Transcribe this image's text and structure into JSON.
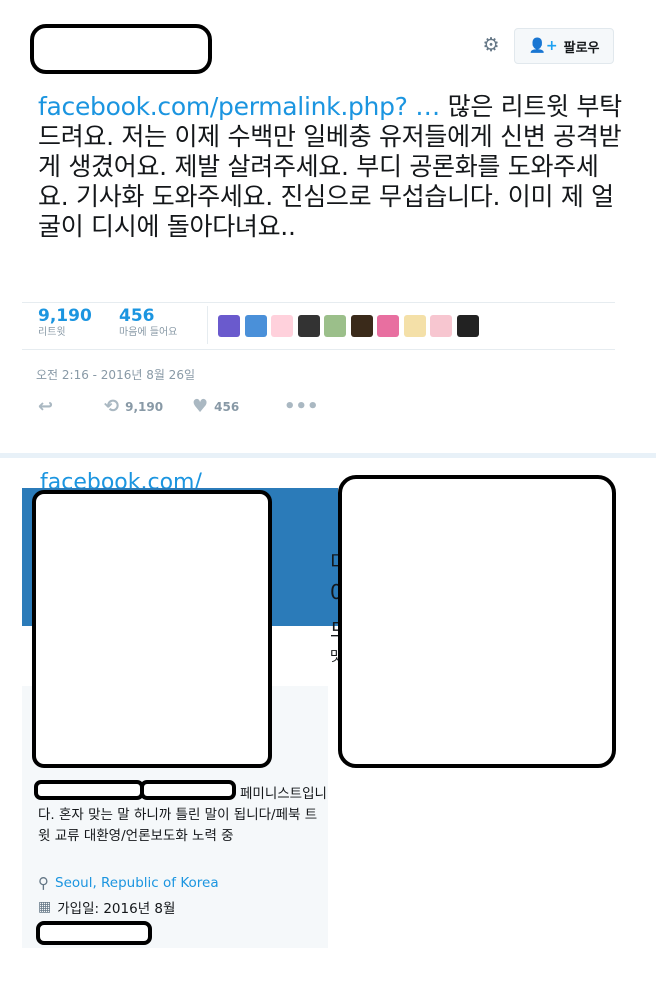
{
  "tweet": {
    "follow_label": "팔로우",
    "link_text": "facebook.com/permalink.php? …",
    "body_text": " 많은 리트윗 부탁드려요. 저는 이제 수백만 일베충 유저들에게 신변 공격받게 생겼어요. 제발 살려주세요. 부디 공론화를 도와주세요. 기사화 도와주세요. 진심으로 무섭습니다. 이미 제 얼굴이 디시에 돌아다녀요..",
    "retweets_count": "9,190",
    "retweets_label": "리트윗",
    "likes_count": "456",
    "likes_label": "마음에 들어요",
    "timestamp": "오전 2:16 - 2016년 8월 26일",
    "action_retweet_count": "9,190",
    "action_like_count": "456",
    "icons": [
      "gear-icon",
      "follow-user-plus-icon",
      "reply-icon",
      "retweet-icon",
      "heart-icon",
      "more-icon"
    ],
    "avatar_colors": [
      "#6a5acd",
      "#4a90d9",
      "#ffd1dc",
      "#333333",
      "#9bbf8a",
      "#3a2a1a",
      "#e86fa0",
      "#f4e0a8",
      "#f7c6d0",
      "#222222"
    ]
  },
  "profile": {
    "bio_text": "페미니스트입니다. 혼자 맞는 말 하니까 틀린 말이 됩니다/페북 트윗 교류 대환영/언론보도화 노력 중",
    "location": "Seoul, Republic of Korea",
    "joined": "가입일: 2016년 8월",
    "url_fragment": "facebook.com/",
    "side_chars": [
      "미",
      "0",
      "므",
      "맛"
    ],
    "icons": [
      "location-pin-icon",
      "calendar-icon"
    ],
    "banner_color": "#2b7bb9"
  }
}
